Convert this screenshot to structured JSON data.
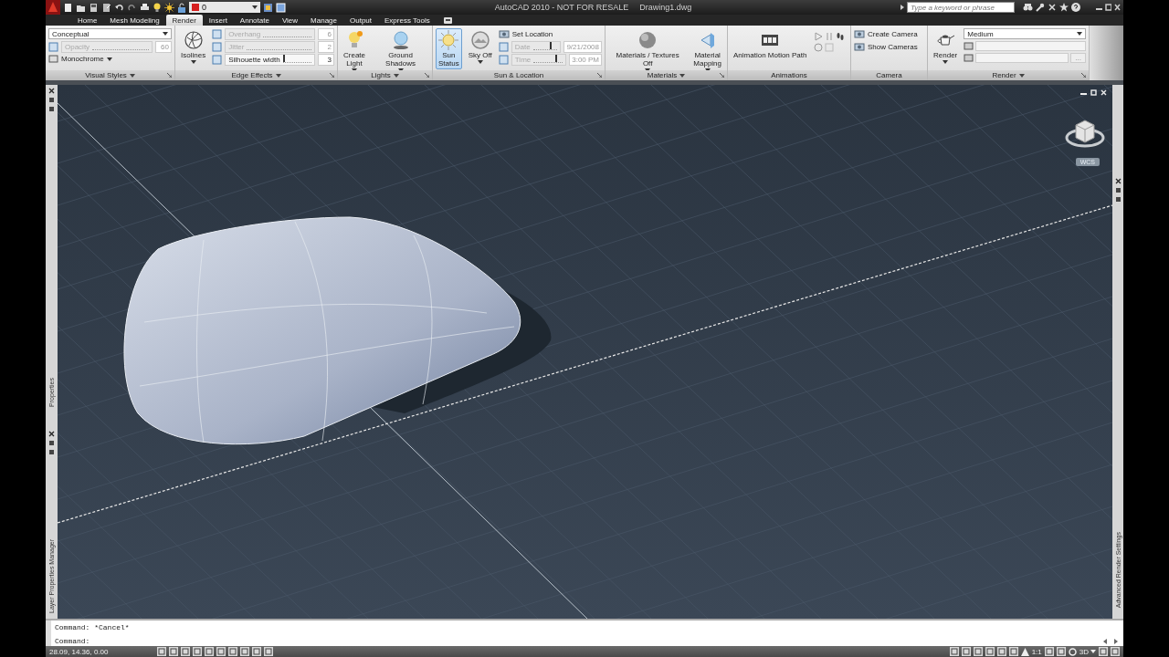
{
  "quick_access": {
    "layer": "0"
  },
  "title": "AutoCAD 2010 - NOT FOR RESALE",
  "document": "Drawing1.dwg",
  "search": {
    "placeholder": "Type a keyword or phrase"
  },
  "tabs": [
    {
      "label": "Home",
      "selected": false
    },
    {
      "label": "Mesh Modeling",
      "selected": false
    },
    {
      "label": "Render",
      "selected": true
    },
    {
      "label": "Insert",
      "selected": false
    },
    {
      "label": "Annotate",
      "selected": false
    },
    {
      "label": "View",
      "selected": false
    },
    {
      "label": "Manage",
      "selected": false
    },
    {
      "label": "Output",
      "selected": false
    },
    {
      "label": "Express Tools",
      "selected": false
    }
  ],
  "panels": [
    {
      "title": "Visual Styles",
      "menu": true,
      "launcher": true,
      "controls": [
        {
          "kind": "dropdown",
          "value": "Conceptual"
        },
        {
          "kind": "slider",
          "label": "Opacity",
          "value": "60",
          "disabled": true
        },
        {
          "kind": "split",
          "label": "Monochrome"
        }
      ]
    },
    {
      "title": "Edge Effects",
      "menu": true,
      "launcher": true,
      "controls": [
        {
          "kind": "big",
          "label": "Isolines",
          "caret": true,
          "selected": false
        },
        {
          "kind": "slider",
          "label": "Overhang",
          "value": "6",
          "disabled": true
        },
        {
          "kind": "slider",
          "label": "Jitter",
          "value": "2",
          "disabled": true
        },
        {
          "kind": "slider",
          "label": "Silhouette width",
          "value": "3",
          "disabled": false,
          "level": 0.02
        }
      ]
    },
    {
      "title": "Lights",
      "menu": true,
      "launcher": true,
      "controls": [
        {
          "kind": "big",
          "label": "Create\nLight",
          "caret": true,
          "selected": false
        },
        {
          "kind": "big",
          "label": "Ground Shadows",
          "caret": true,
          "selected": false
        }
      ]
    },
    {
      "title": "Sun & Location",
      "menu": false,
      "launcher": true,
      "controls": [
        {
          "kind": "big",
          "label": "Sun\nStatus",
          "caret": false,
          "selected": true
        },
        {
          "kind": "big",
          "label": "Sky Off",
          "caret": true,
          "selected": false
        },
        {
          "kind": "link",
          "label": "Set Location"
        },
        {
          "kind": "slider",
          "label": "Date",
          "value": "9/21/2008",
          "disabled": true,
          "level": 0.7
        },
        {
          "kind": "slider",
          "label": "Time",
          "value": "3:00 PM",
          "disabled": true,
          "level": 0.75
        }
      ]
    },
    {
      "title": "Materials",
      "menu": true,
      "launcher": true,
      "controls": [
        {
          "kind": "big",
          "label": "Materials / Textures Off",
          "caret": true,
          "selected": false
        },
        {
          "kind": "big",
          "label": "Material\nMapping",
          "caret": true,
          "selected": false
        }
      ]
    },
    {
      "title": "Animations",
      "menu": false,
      "controls": [
        {
          "kind": "big",
          "label": "Animation Motion Path",
          "caret": false,
          "selected": false
        },
        {
          "kind": "playback"
        }
      ]
    },
    {
      "title": "Camera",
      "menu": false,
      "controls": [
        {
          "kind": "link",
          "label": "Create Camera"
        },
        {
          "kind": "link",
          "label": "Show  Cameras"
        }
      ]
    },
    {
      "title": "Render",
      "menu": true,
      "launcher": true,
      "controls": [
        {
          "kind": "big",
          "label": "Render",
          "caret": true,
          "selected": false
        },
        {
          "kind": "dropdown",
          "value": "Medium"
        },
        {
          "kind": "field"
        },
        {
          "kind": "field",
          "button": "..."
        }
      ]
    }
  ],
  "viewport": {
    "ucs_label": "WCS"
  },
  "palettes": [
    {
      "title": "Properties"
    },
    {
      "title": "Layer Properties Manager"
    },
    {
      "title": "Advanced Render Settings"
    }
  ],
  "command_line": {
    "history": [
      "Command: *Cancel*"
    ],
    "prompt": "Command:"
  },
  "status_bar": {
    "coordinates": "28.09, 14.36, 0.00",
    "annotation_scale": "1:1",
    "workspace": "3D"
  }
}
